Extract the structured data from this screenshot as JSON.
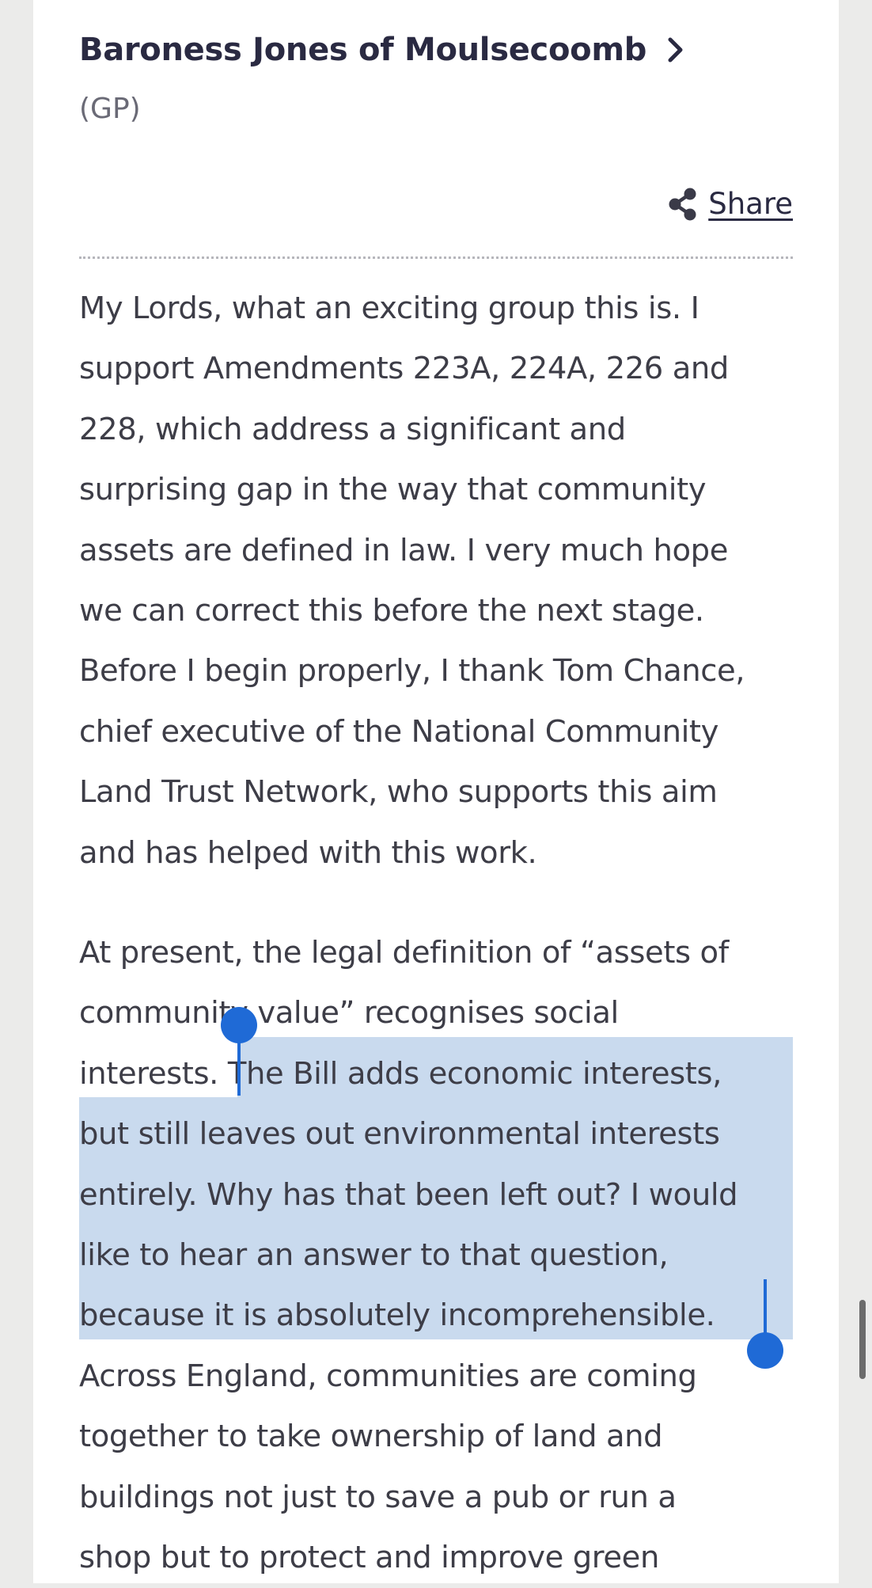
{
  "speaker": {
    "name": "Baroness Jones of Moulsecoomb",
    "party": "(GP)"
  },
  "share": {
    "label": "Share",
    "icon": "share-icon"
  },
  "icons": {
    "chevron": "chevron-right-icon"
  },
  "colors": {
    "text": "#3d3d47",
    "heading": "#2a2a42",
    "selection_highlight": "#c9daee",
    "selection_handle": "#1f6ad6"
  },
  "paragraphs": [
    {
      "lines": [
        "My Lords, what an exciting group this is. I",
        "support Amendments 223A, 224A, 226 and",
        "228, which address a significant and",
        "surprising gap in the way that community",
        "assets are defined in law. I very much hope",
        "we can correct this before the next stage.",
        "Before I begin properly, I thank Tom Chance,",
        "chief executive of the National Community",
        "Land Trust Network, who supports this aim",
        "and has helped with this work."
      ]
    },
    {
      "lines": [
        "At present, the legal definition of “assets of",
        "community value” recognises social",
        "interests. The Bill adds economic interests,",
        "but still leaves out environmental interests",
        "entirely. Why has that been left out? I would",
        "like to hear an answer to that question,",
        "because it is absolutely incomprehensible.",
        "Across England, communities are coming",
        "together to take ownership of land and",
        "buildings not just to save a pub or run a",
        "shop but to protect and improve green"
      ]
    }
  ],
  "selection": {
    "text": "The Bill adds economic interests, but still leaves out environmental interests entirely. Why has that been left out? I would like to hear an answer to that question, because it is absolutely incomprehensible."
  }
}
